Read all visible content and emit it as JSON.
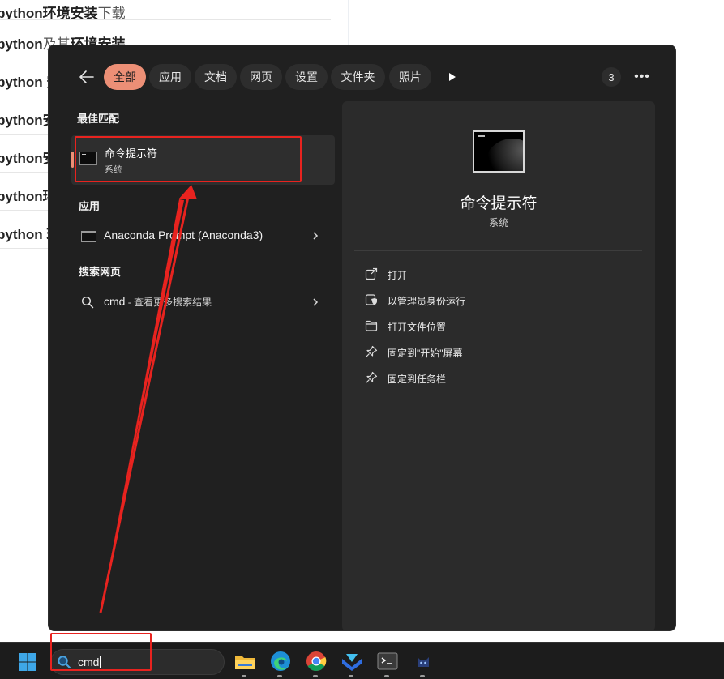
{
  "background_page": {
    "rows": [
      {
        "bold": "python环境安装",
        "normal": "下载"
      },
      {
        "bold": "python",
        "normal": "及其",
        "bold2": "环境安装"
      },
      {
        "bold": "python 安"
      },
      {
        "bold": "python安"
      },
      {
        "bold": "python安"
      },
      {
        "bold": "python环"
      },
      {
        "bold": "python 环"
      }
    ]
  },
  "search_flyout": {
    "filters": [
      "全部",
      "应用",
      "文档",
      "网页",
      "设置",
      "文件夹",
      "照片"
    ],
    "result_count": "3",
    "best_match": {
      "heading": "最佳匹配",
      "title": "命令提示符",
      "subtitle": "系统"
    },
    "apps": {
      "heading": "应用",
      "items": [
        {
          "label": "Anaconda Prompt (Anaconda3)"
        }
      ]
    },
    "web": {
      "heading": "搜索网页",
      "query": "cmd",
      "suffix": " - 查看更多搜索结果"
    },
    "preview": {
      "title": "命令提示符",
      "subtitle": "系统",
      "actions": [
        "打开",
        "以管理员身份运行",
        "打开文件位置",
        "固定到\"开始\"屏幕",
        "固定到任务栏"
      ]
    }
  },
  "taskbar": {
    "search_value": "cmd",
    "apps": [
      "file-explorer-icon",
      "edge-icon",
      "chrome-icon",
      "app-icon",
      "terminal-icon",
      "cat-app-icon"
    ]
  },
  "colors": {
    "accent": "#ec8f76",
    "annotation": "#e8231f",
    "flyout_bg": "#202020",
    "preview_bg": "#2b2b2b"
  }
}
